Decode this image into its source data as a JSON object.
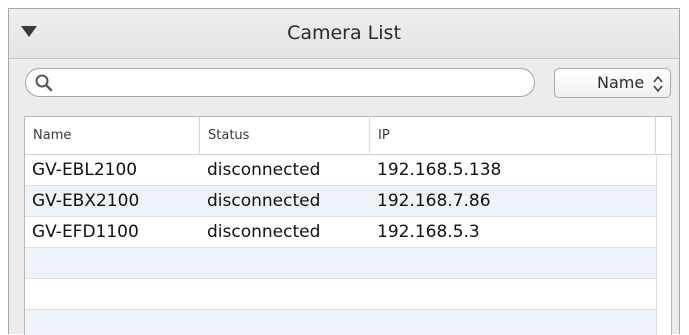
{
  "panel": {
    "title": "Camera List"
  },
  "search": {
    "value": "",
    "placeholder": ""
  },
  "sort": {
    "selected": "Name"
  },
  "table": {
    "columns": [
      "Name",
      "Status",
      "IP"
    ],
    "rows": [
      {
        "name": "GV-EBL2100",
        "status": "disconnected",
        "ip": "192.168.5.138"
      },
      {
        "name": "GV-EBX2100",
        "status": "disconnected",
        "ip": "192.168.7.86"
      },
      {
        "name": "GV-EFD1100",
        "status": "disconnected",
        "ip": "192.168.5.3"
      },
      {
        "name": "",
        "status": "",
        "ip": ""
      },
      {
        "name": "",
        "status": "",
        "ip": ""
      },
      {
        "name": "",
        "status": "",
        "ip": ""
      }
    ]
  },
  "icons": {
    "collapse": "triangle-down-icon",
    "search": "search-icon",
    "sort": "up-down-arrows-icon"
  },
  "colors": {
    "panel_bg": "#ececec",
    "alt_row": "#eef3fa",
    "border": "#a9a9a9"
  }
}
